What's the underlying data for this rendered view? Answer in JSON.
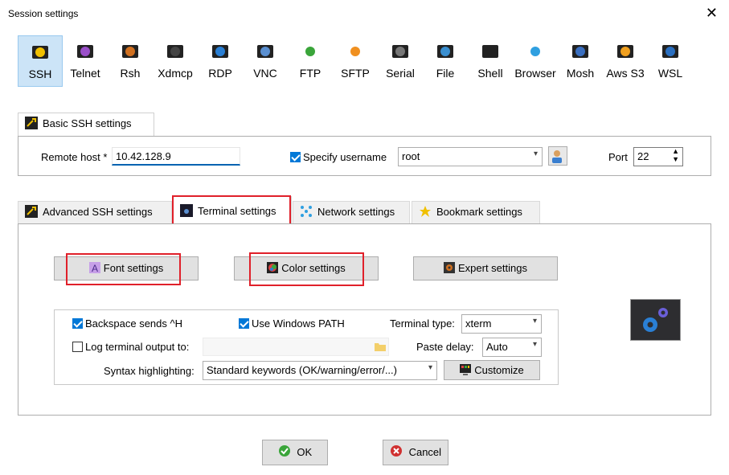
{
  "window": {
    "title": "Session settings"
  },
  "protocols": [
    {
      "id": "ssh",
      "label": "SSH",
      "icon": "ssh-key-icon",
      "color": "#f0c000",
      "selected": true
    },
    {
      "id": "telnet",
      "label": "Telnet",
      "icon": "telnet-icon",
      "color": "#9a4fc9"
    },
    {
      "id": "rsh",
      "label": "Rsh",
      "icon": "rsh-icon",
      "color": "#d07020"
    },
    {
      "id": "xdmcp",
      "label": "Xdmcp",
      "icon": "xdmcp-icon",
      "color": "#444444"
    },
    {
      "id": "rdp",
      "label": "RDP",
      "icon": "rdp-monitor-icon",
      "color": "#2a7fd4"
    },
    {
      "id": "vnc",
      "label": "VNC",
      "icon": "vnc-icon",
      "color": "#5a8fd0"
    },
    {
      "id": "ftp",
      "label": "FTP",
      "icon": "ftp-globe-icon",
      "color": "#3aa53a"
    },
    {
      "id": "sftp",
      "label": "SFTP",
      "icon": "sftp-globe-icon",
      "color": "#f09020"
    },
    {
      "id": "serial",
      "label": "Serial",
      "icon": "serial-plug-icon",
      "color": "#777777"
    },
    {
      "id": "file",
      "label": "File",
      "icon": "file-monitor-icon",
      "color": "#3a8fd0"
    },
    {
      "id": "shell",
      "label": "Shell",
      "icon": "shell-terminal-icon",
      "color": "#222222"
    },
    {
      "id": "browser",
      "label": "Browser",
      "icon": "browser-globe-icon",
      "color": "#2f9fe0"
    },
    {
      "id": "mosh",
      "label": "Mosh",
      "icon": "mosh-satellite-icon",
      "color": "#3a6fc0"
    },
    {
      "id": "aws",
      "label": "Aws S3",
      "icon": "aws-s3-cubes-icon",
      "color": "#f0a020"
    },
    {
      "id": "wsl",
      "label": "WSL",
      "icon": "wsl-windows-icon",
      "color": "#2a6fc0"
    }
  ],
  "basic": {
    "tab_label": "Basic SSH settings",
    "remote_host_label": "Remote host *",
    "remote_host_value": "10.42.128.9",
    "specify_username_label": "Specify username",
    "specify_username_checked": true,
    "username_value": "root",
    "port_label": "Port",
    "port_value": "22"
  },
  "tabs": [
    {
      "label": "Advanced SSH settings",
      "icon": "wrench-key-icon",
      "active": false
    },
    {
      "label": "Terminal settings",
      "icon": "terminal-icon",
      "active": true
    },
    {
      "label": "Network settings",
      "icon": "network-icon",
      "active": false
    },
    {
      "label": "Bookmark settings",
      "icon": "star-icon",
      "active": false
    }
  ],
  "terminal": {
    "font_button": "Font settings",
    "color_button": "Color settings",
    "expert_button": "Expert settings",
    "backspace_label": "Backspace sends ^H",
    "backspace_checked": true,
    "use_windows_path_label": "Use Windows PATH",
    "use_windows_path_checked": true,
    "terminal_type_label": "Terminal type:",
    "terminal_type_value": "xterm",
    "log_output_label": "Log terminal output to:",
    "log_output_checked": false,
    "log_output_path": "",
    "paste_delay_label": "Paste delay:",
    "paste_delay_value": "Auto",
    "syntax_label": "Syntax highlighting:",
    "syntax_value": "Standard keywords (OK/warning/error/...)",
    "customize_button": "Customize"
  },
  "footer": {
    "ok": "OK",
    "cancel": "Cancel"
  },
  "colors": {
    "accent": "#0078d7",
    "highlight": "#e0202a",
    "selected_bg": "#cce4f7"
  }
}
